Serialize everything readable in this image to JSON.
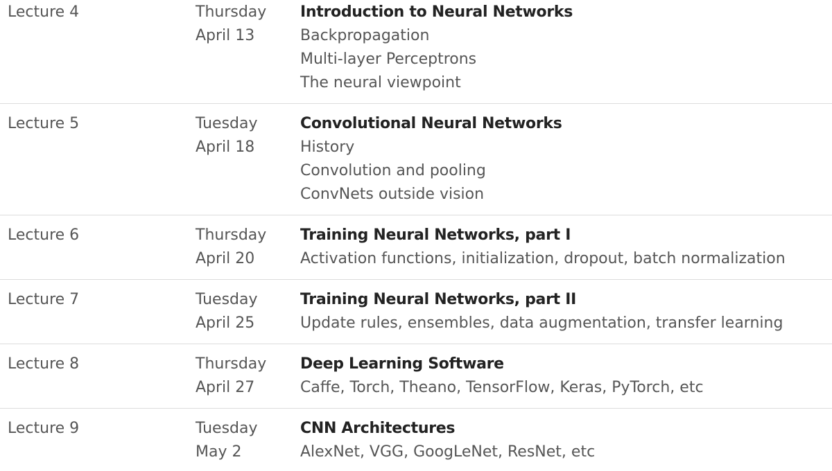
{
  "schedule": {
    "rows": [
      {
        "lecture": "Lecture 4",
        "day": "Thursday",
        "date": "April 13",
        "title": "Introduction to Neural Networks",
        "subtopics": [
          "Backpropagation",
          "Multi-layer Perceptrons",
          "The neural viewpoint"
        ]
      },
      {
        "lecture": "Lecture 5",
        "day": "Tuesday",
        "date": "April 18",
        "title": "Convolutional Neural Networks",
        "subtopics": [
          "History",
          "Convolution and pooling",
          "ConvNets outside vision"
        ]
      },
      {
        "lecture": "Lecture 6",
        "day": "Thursday",
        "date": "April 20",
        "title": "Training Neural Networks, part I",
        "subtopics": [
          "Activation functions, initialization, dropout, batch normalization"
        ]
      },
      {
        "lecture": "Lecture 7",
        "day": "Tuesday",
        "date": "April 25",
        "title": "Training Neural Networks, part II",
        "subtopics": [
          "Update rules, ensembles, data augmentation, transfer learning"
        ]
      },
      {
        "lecture": "Lecture 8",
        "day": "Thursday",
        "date": "April 27",
        "title": "Deep Learning Software",
        "subtopics": [
          "Caffe, Torch, Theano, TensorFlow, Keras, PyTorch, etc"
        ]
      },
      {
        "lecture": "Lecture 9",
        "day": "Tuesday",
        "date": "May 2",
        "title": "CNN Architectures",
        "subtopics": [
          "AlexNet, VGG, GoogLeNet, ResNet, etc"
        ]
      }
    ]
  }
}
